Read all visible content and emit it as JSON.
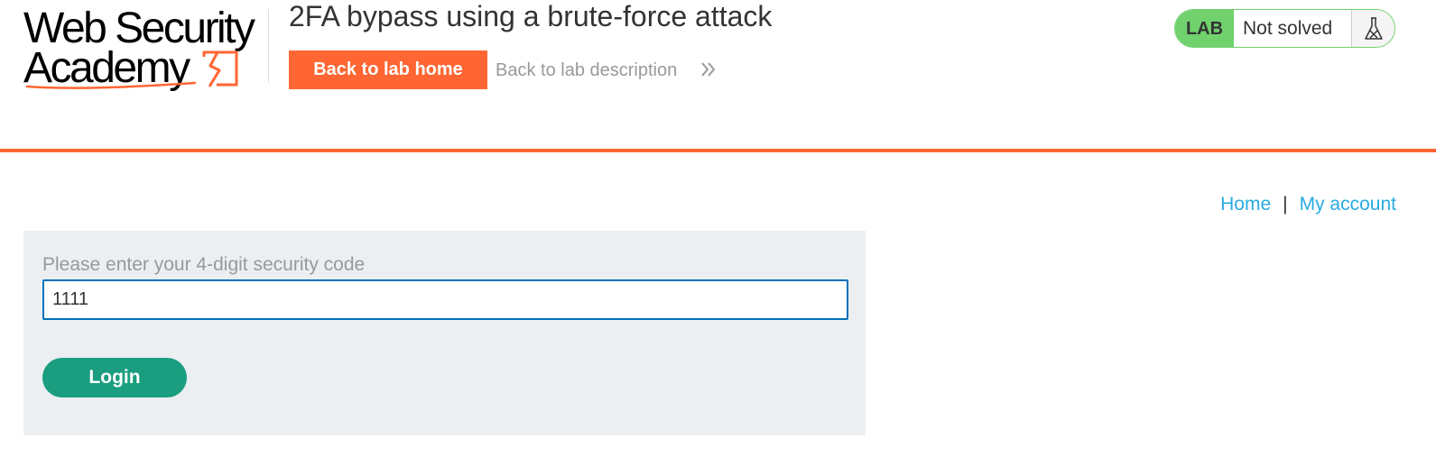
{
  "brand": {
    "logo_line1": "Web Security",
    "logo_line2": "Academy",
    "logo_icon": "lightning-bolt-icon",
    "accent_color": "#ff6633"
  },
  "header": {
    "lab_title": "2FA bypass using a brute-force attack",
    "back_home_label": "Back to lab home",
    "back_description_label": "Back to lab description",
    "back_description_icon": "double-chevron-right-icon"
  },
  "status": {
    "tag": "LAB",
    "text": "Not solved",
    "icon": "flask-icon",
    "color": "#70d16d"
  },
  "nav": {
    "home_label": "Home",
    "separator": "|",
    "account_label": "My account",
    "link_color": "#29abe0"
  },
  "form": {
    "code_label": "Please enter your 4-digit security code",
    "code_value": "1111",
    "submit_label": "Login",
    "submit_color": "#1a9e7f"
  }
}
